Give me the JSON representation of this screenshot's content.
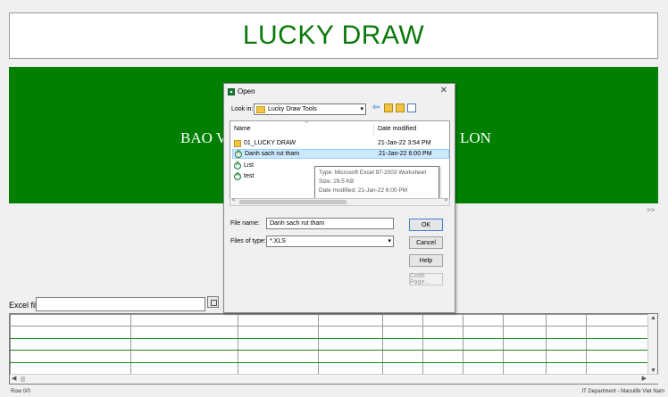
{
  "app": {
    "title": "LUCKY DRAW",
    "banner_left": "BAO V",
    "banner_right": "LON",
    "scroll_arrows": ">>"
  },
  "excel": {
    "label": "Excel file",
    "value": ""
  },
  "status": {
    "left": "Row 0/0",
    "right": "IT Department - Manulife Viet Nam"
  },
  "dialog": {
    "title": "Open",
    "close": "✕",
    "look_in_label": "Look in:",
    "look_in_value": "Lucky Draw Tools",
    "columns": {
      "name": "Name",
      "date": "Date modified"
    },
    "files": [
      {
        "name": "01_LUCKY DRAW",
        "date": "21-Jan-22 3:54 PM",
        "type": "folder"
      },
      {
        "name": "Danh sach rut tham",
        "date": "21-Jan-22 6:00 PM",
        "type": "xls"
      },
      {
        "name": "List",
        "date": "",
        "type": "xls"
      },
      {
        "name": "test",
        "date": "",
        "type": "xls"
      }
    ],
    "tooltip": {
      "type": "Type: Microsoft Excel 97-2003 Worksheet",
      "size": "Size: 29.5 KB",
      "modified": "Date modified: 21-Jan-22 6:00 PM"
    },
    "file_name_label": "File name:",
    "file_name_value": "Danh sach rut tham",
    "files_of_type_label": "Files of type:",
    "files_of_type_value": "*.XLS",
    "buttons": {
      "ok": "OK",
      "cancel": "Cancel",
      "help": "Help",
      "code_page": "Code Page..."
    }
  }
}
